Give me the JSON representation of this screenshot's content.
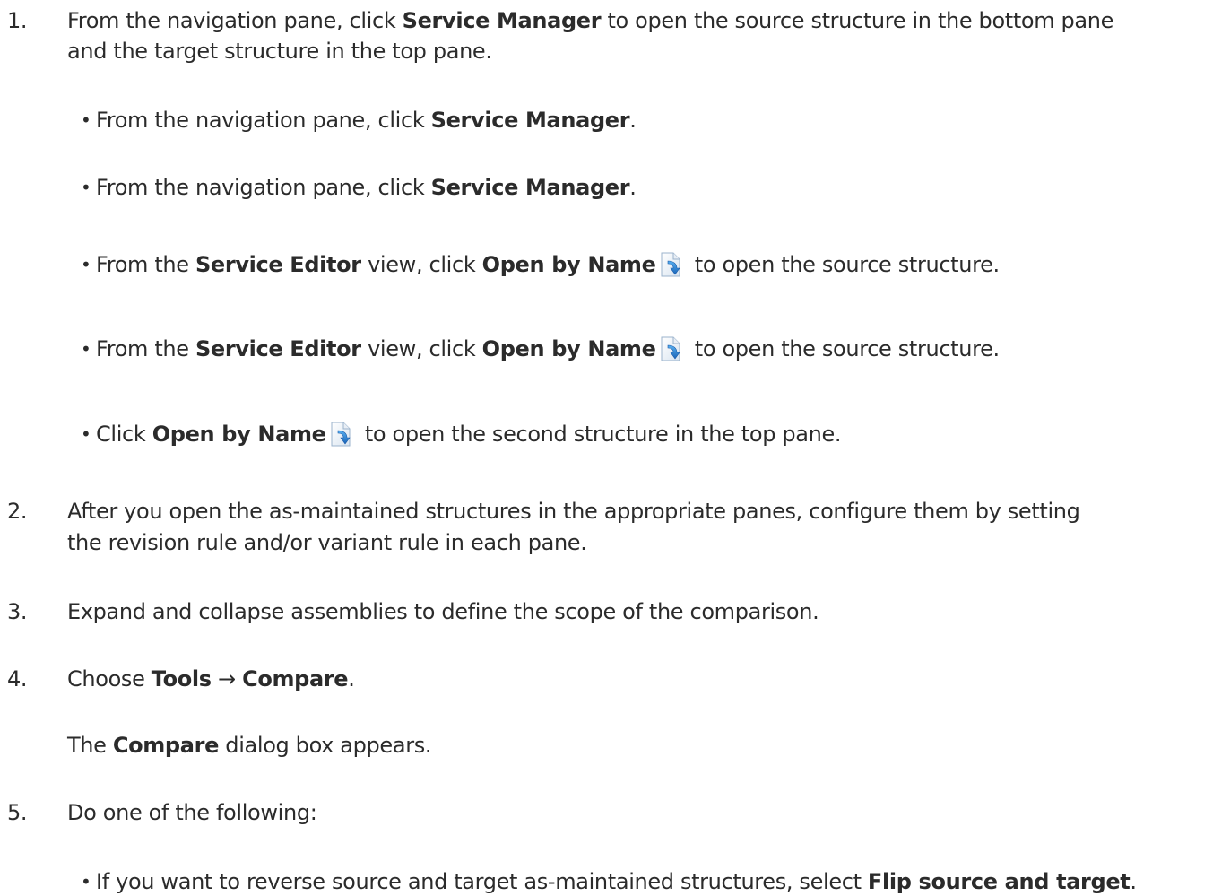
{
  "steps": [
    {
      "number": "1.",
      "line1": {
        "a": "From the navigation pane, click ",
        "b": "Service Manager",
        "c": " to open the source structure in the bottom pane"
      },
      "line2": "and the target structure in the top pane.",
      "bullets": [
        {
          "a": "From the navigation pane, click ",
          "b": "Service Manager",
          "c": "."
        },
        {
          "a": "From the navigation pane, click ",
          "b": "Service Manager",
          "c": "."
        },
        {
          "a": "From the ",
          "b": "Service Editor",
          "c": " view, click ",
          "d": "Open by Name",
          "e": " to open the source structure.",
          "icon": "open-by-name-icon"
        },
        {
          "a": "From the ",
          "b": "Service Editor",
          "c": " view, click ",
          "d": "Open by Name",
          "e": " to open the source structure.",
          "icon": "open-by-name-icon"
        },
        {
          "a": "Click ",
          "b": "Open by Name",
          "c": " to open the second structure in the top pane.",
          "icon": "open-by-name-icon"
        }
      ]
    },
    {
      "number": "2.",
      "line1": "After you open the as-maintained structures in the appropriate panes, configure them by setting",
      "line2": "the revision rule and/or variant rule in each pane."
    },
    {
      "number": "3.",
      "line1": "Expand and collapse assemblies to define the scope of the comparison."
    },
    {
      "number": "4.",
      "line1": {
        "a": "Choose ",
        "b": "Tools",
        "c": " → ",
        "d": "Compare",
        "e": "."
      },
      "result": {
        "a": "The ",
        "b": "Compare",
        "c": " dialog box appears."
      }
    },
    {
      "number": "5.",
      "line1": "Do one of the following:",
      "bullets": [
        {
          "a": "If you want to reverse source and target as-maintained structures, select ",
          "b": "Flip source and target",
          "c": "."
        }
      ]
    }
  ],
  "colors": {
    "text": "#2b2b2b",
    "icon_page": "#f4f8fc",
    "icon_arrow": "#2a7fd4"
  }
}
